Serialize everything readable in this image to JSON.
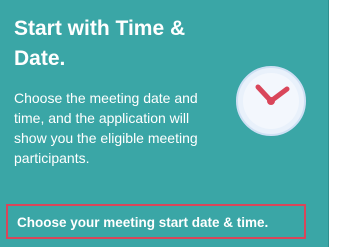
{
  "card": {
    "title": "Start with Time & Date.",
    "description": "Choose the meeting date and time, and the application will show you the eligible meeting participants.",
    "cta_label": "Choose your meeting start date & time.",
    "icon": "clock-icon",
    "colors": {
      "background": "#3aa6a6",
      "highlight_border": "#d9465a",
      "clock_face": "#e9f1fb",
      "clock_hands": "#d9465a"
    }
  }
}
